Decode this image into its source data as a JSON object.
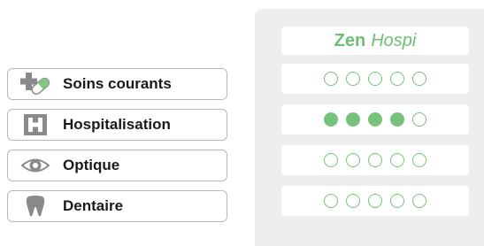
{
  "categories": [
    {
      "label": "Soins courants",
      "icon": "pill-cross-icon"
    },
    {
      "label": "Hospitalisation",
      "icon": "hospital-h-icon"
    },
    {
      "label": "Optique",
      "icon": "eye-icon"
    },
    {
      "label": "Dentaire",
      "icon": "tooth-icon"
    }
  ],
  "plan": {
    "name_bold": "Zen",
    "name_italic": "Hospi"
  },
  "ratings": [
    {
      "category": "Soins courants",
      "filled": 0,
      "max": 5
    },
    {
      "category": "Hospitalisation",
      "filled": 4,
      "max": 5
    },
    {
      "category": "Optique",
      "filled": 0,
      "max": 5
    },
    {
      "category": "Dentaire",
      "filled": 0,
      "max": 5
    }
  ],
  "colors": {
    "accent": "#77c27a",
    "panel_bg": "#eeeeee",
    "border": "#b8b8b8",
    "icon_gray": "#9a9a9a",
    "icon_accent": "#7fc785"
  }
}
